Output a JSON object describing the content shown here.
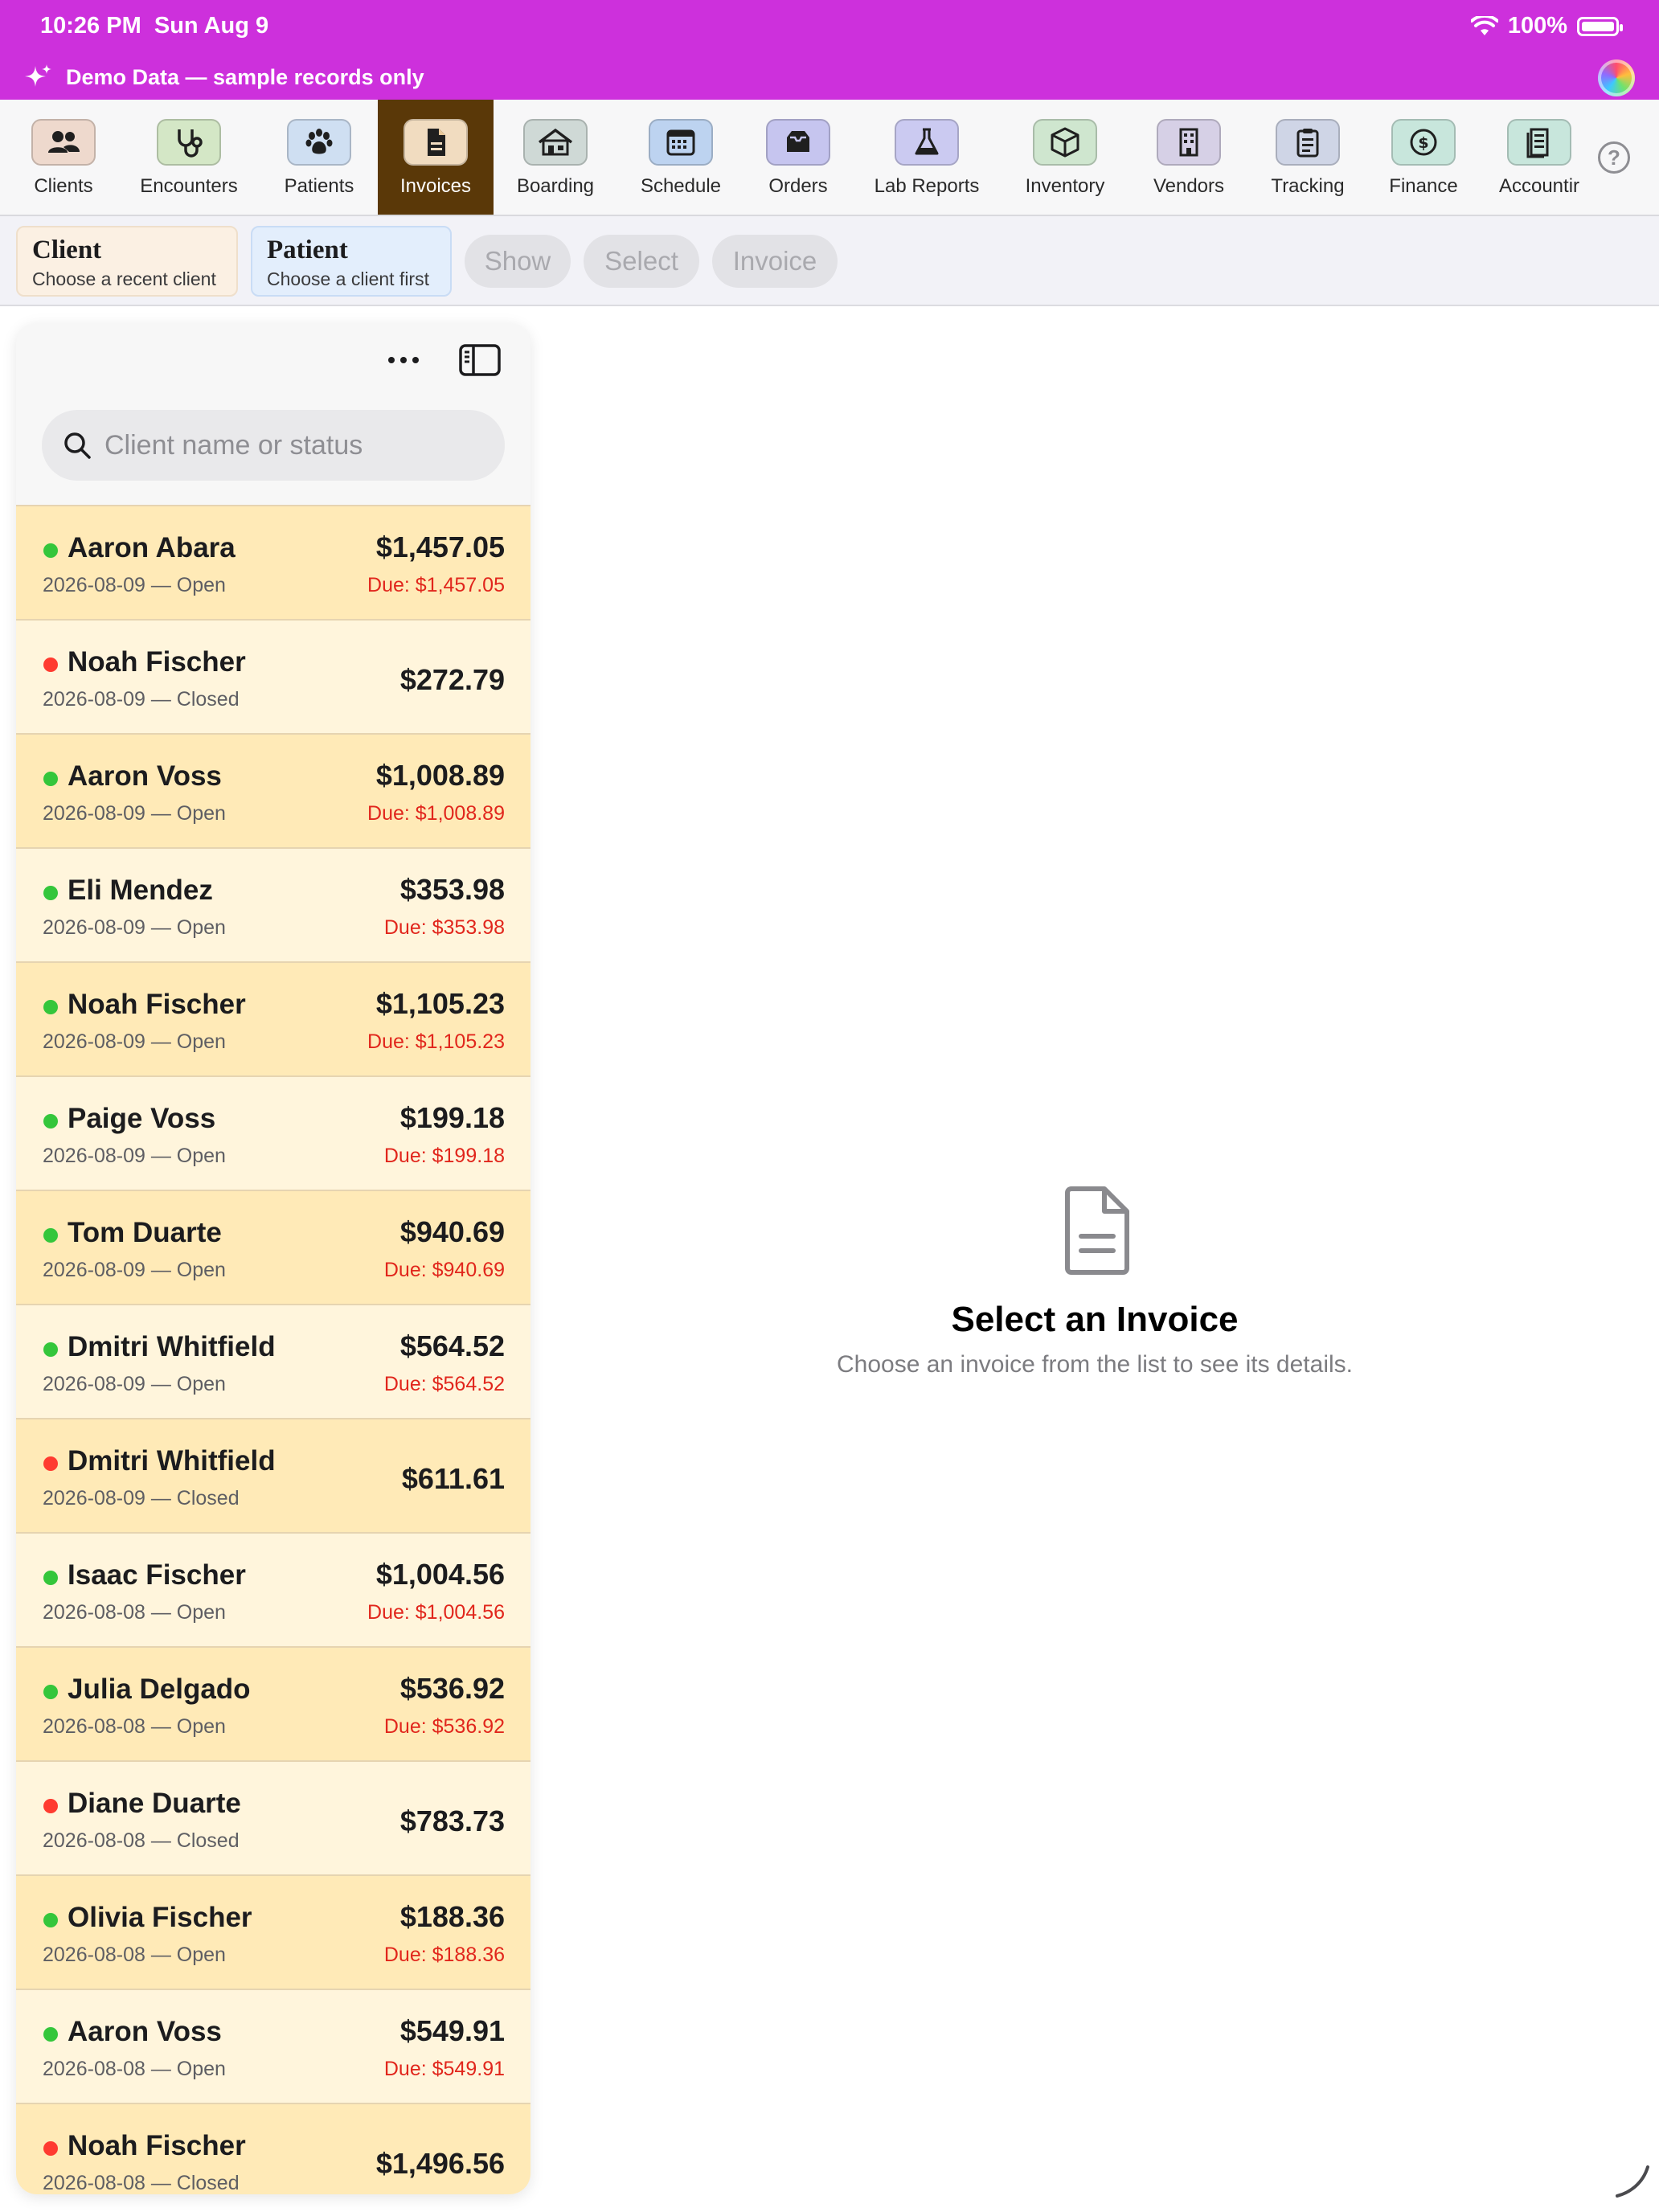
{
  "status_bar": {
    "time": "10:26 PM",
    "date": "Sun Aug 9",
    "battery": "100%",
    "battery_level": 1.0
  },
  "banner": {
    "icon": "sparkle-icon",
    "text": "Demo Data — sample records only",
    "color": "#cd30dc"
  },
  "modules": [
    {
      "label": "Clients",
      "icon": "people-icon",
      "tile_color": "#eed9cd",
      "active": false
    },
    {
      "label": "Encounters",
      "icon": "stethoscope-icon",
      "tile_color": "#d4e7c6",
      "active": false
    },
    {
      "label": "Patients",
      "icon": "paw-icon",
      "tile_color": "#cfdff2",
      "active": false
    },
    {
      "label": "Invoices",
      "icon": "document-icon",
      "tile_color": "#f1dcc0",
      "active": true
    },
    {
      "label": "Boarding",
      "icon": "house-icon",
      "tile_color": "#cfd9d6",
      "active": false
    },
    {
      "label": "Schedule",
      "icon": "calendar-icon",
      "tile_color": "#bdd3f0",
      "active": false
    },
    {
      "label": "Orders",
      "icon": "tray-icon",
      "tile_color": "#c6c5ef",
      "active": false
    },
    {
      "label": "Lab Reports",
      "icon": "flask-icon",
      "tile_color": "#cbcaf1",
      "active": false
    },
    {
      "label": "Inventory",
      "icon": "box-icon",
      "tile_color": "#cfe6cf",
      "active": false
    },
    {
      "label": "Vendors",
      "icon": "building-icon",
      "tile_color": "#d6d0e6",
      "active": false
    },
    {
      "label": "Tracking",
      "icon": "clipboard-icon",
      "tile_color": "#cfd5e6",
      "active": false
    },
    {
      "label": "Finance",
      "icon": "dollar-icon",
      "tile_color": "#c8e6dc",
      "active": false
    },
    {
      "label": "Accountir",
      "icon": "ledger-icon",
      "tile_color": "#c8e6dc",
      "active": false
    }
  ],
  "context": {
    "client": {
      "title": "Client",
      "subtitle": "Choose a recent client"
    },
    "patient": {
      "title": "Patient",
      "subtitle": "Choose a client first"
    },
    "actions": [
      "Show",
      "Select",
      "Invoice"
    ]
  },
  "sidebar": {
    "search_placeholder": "Client name or status",
    "invoices": [
      {
        "name": "Aaron Abara",
        "date": "2026-08-09",
        "status": "Open",
        "amount": "$1,457.05",
        "due": "Due: $1,457.05"
      },
      {
        "name": "Noah Fischer",
        "date": "2026-08-09",
        "status": "Closed",
        "amount": "$272.79",
        "due": ""
      },
      {
        "name": "Aaron Voss",
        "date": "2026-08-09",
        "status": "Open",
        "amount": "$1,008.89",
        "due": "Due: $1,008.89"
      },
      {
        "name": "Eli Mendez",
        "date": "2026-08-09",
        "status": "Open",
        "amount": "$353.98",
        "due": "Due: $353.98"
      },
      {
        "name": "Noah Fischer",
        "date": "2026-08-09",
        "status": "Open",
        "amount": "$1,105.23",
        "due": "Due: $1,105.23"
      },
      {
        "name": "Paige Voss",
        "date": "2026-08-09",
        "status": "Open",
        "amount": "$199.18",
        "due": "Due: $199.18"
      },
      {
        "name": "Tom Duarte",
        "date": "2026-08-09",
        "status": "Open",
        "amount": "$940.69",
        "due": "Due: $940.69"
      },
      {
        "name": "Dmitri Whitfield",
        "date": "2026-08-09",
        "status": "Open",
        "amount": "$564.52",
        "due": "Due: $564.52"
      },
      {
        "name": "Dmitri Whitfield",
        "date": "2026-08-09",
        "status": "Closed",
        "amount": "$611.61",
        "due": ""
      },
      {
        "name": "Isaac Fischer",
        "date": "2026-08-08",
        "status": "Open",
        "amount": "$1,004.56",
        "due": "Due: $1,004.56"
      },
      {
        "name": "Julia Delgado",
        "date": "2026-08-08",
        "status": "Open",
        "amount": "$536.92",
        "due": "Due: $536.92"
      },
      {
        "name": "Diane Duarte",
        "date": "2026-08-08",
        "status": "Closed",
        "amount": "$783.73",
        "due": ""
      },
      {
        "name": "Olivia Fischer",
        "date": "2026-08-08",
        "status": "Open",
        "amount": "$188.36",
        "due": "Due: $188.36"
      },
      {
        "name": "Aaron Voss",
        "date": "2026-08-08",
        "status": "Open",
        "amount": "$549.91",
        "due": "Due: $549.91"
      },
      {
        "name": "Noah Fischer",
        "date": "2026-08-08",
        "status": "Closed",
        "amount": "$1,496.56",
        "due": ""
      }
    ]
  },
  "detail_empty": {
    "icon": "document-icon",
    "title": "Select an Invoice",
    "subtitle": "Choose an invoice from the list to see its details."
  },
  "colors": {
    "open_dot": "#34c63b",
    "closed_dot": "#ff3b30",
    "due_text": "#e1261c",
    "active_module": "#5a3808"
  }
}
